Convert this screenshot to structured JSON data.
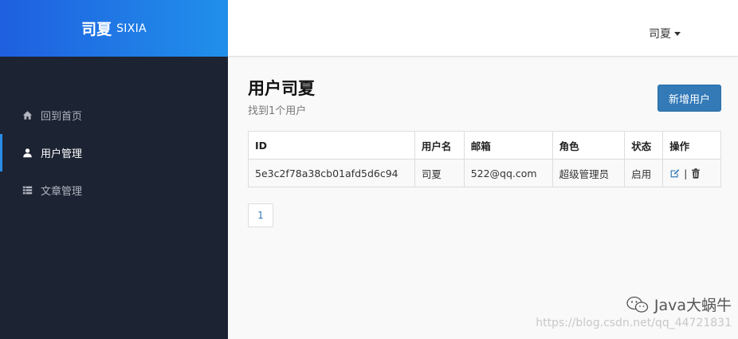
{
  "brand": {
    "name_cn": "司夏",
    "name_en": "SIXIA"
  },
  "header": {
    "user": "司夏"
  },
  "sidebar": {
    "items": [
      {
        "label": "回到首页",
        "icon": "home-icon",
        "active": false
      },
      {
        "label": "用户管理",
        "icon": "user-icon",
        "active": true
      },
      {
        "label": "文章管理",
        "icon": "list-icon",
        "active": false
      }
    ]
  },
  "main": {
    "title": "用户司夏",
    "subtitle": "找到1个用户",
    "add_button": "新增用户"
  },
  "table": {
    "headers": [
      "ID",
      "用户名",
      "邮箱",
      "角色",
      "状态",
      "操作"
    ],
    "rows": [
      {
        "id": "5e3c2f78a38cb01afd5d6c94",
        "username": "司夏",
        "email": "522@qq.com",
        "role": "超级管理员",
        "status": "启用",
        "op_separator": "|"
      }
    ]
  },
  "pagination": {
    "current": "1"
  },
  "watermark": {
    "brand": "Java大蜗牛",
    "url": "https://blog.csdn.net/qq_44721831"
  },
  "colors": {
    "brand_start": "#1f5fe0",
    "brand_end": "#2090ea",
    "sidebar_bg": "#1c2332",
    "primary": "#337ab7",
    "active_bar": "#2a8de4"
  }
}
